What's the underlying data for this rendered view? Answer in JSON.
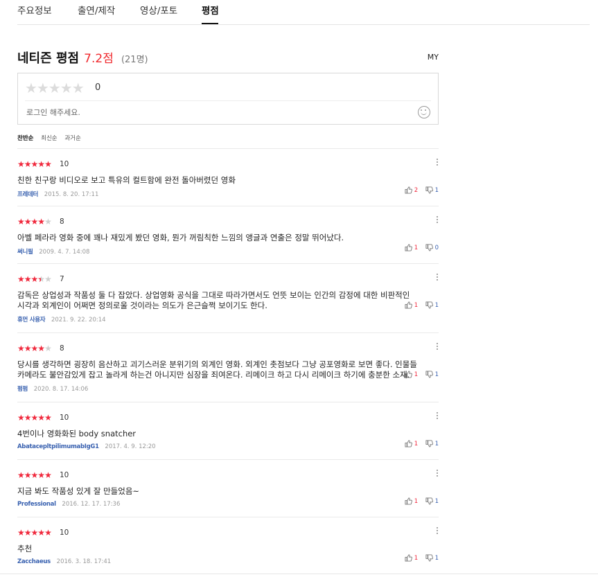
{
  "tabs": [
    "주요정보",
    "출연/제작",
    "영상/포토",
    "평점"
  ],
  "active_tab": "평점",
  "rating": {
    "title": "네티즌 평점",
    "score": "7.2점",
    "count": "(21명)",
    "my_label": "MY"
  },
  "input": {
    "stars": "★★★★★",
    "score": "0",
    "placeholder": "로그인 해주세요.",
    "emoji_icon": "smile-icon"
  },
  "sort": [
    "찬반순",
    "최신순",
    "과거순"
  ],
  "colors": {
    "accent": "#f0283c",
    "author": "#3a62b0",
    "star_off": "#cfcfcf"
  },
  "reviews": [
    {
      "rating": 5,
      "score": "10",
      "text": "친한 친구랑 비디오로 보고 특유의 컬트함에 완전 돌아버렸던 영화",
      "author": "프레데터",
      "date": "2015. 8. 20. 17:11",
      "likes": "2",
      "dislikes": "1"
    },
    {
      "rating": 4,
      "score": "8",
      "text": "아벨 페라라 영화 중에 꽤나 재밌게 봤던 영화, 뭔가 꺼림칙한 느낌의 앵글과 연출은 정말 뛰어났다.",
      "author": "써니필",
      "date": "2009. 4. 7. 14:08",
      "likes": "1",
      "dislikes": "0"
    },
    {
      "rating": 3.5,
      "score": "7",
      "text": "감독은 상업성과 작품성 둘 다 잡았다. 상업영화 공식을 그대로 따라가면서도 언뜻 보이는 인간의 감정에 대한 비판적인\n시각과 외계인이 어쩌면 정의로울 것이라는 의도가 은근슬쩍 보이기도 한다.",
      "author": "휴먼 사용자",
      "date": "2021. 9. 22. 20:14",
      "likes": "1",
      "dislikes": "1"
    },
    {
      "rating": 4,
      "score": "8",
      "text": "당시를 생각하면 굉장히 음산하고 괴기스러운 분위기의 외계인 영화. 외계인 촛점보다 그냥 공포영화로 보면 좋다. 인물들\n카메라도 불안감있게 잡고 놀라게 하는건 아니지만 심장을 죄여온다. 리메이크 하고 다시 리메이크 하기에 충분한 소재.",
      "author": "펌펌",
      "date": "2020. 8. 17. 14:06",
      "likes": "1",
      "dislikes": "1"
    },
    {
      "rating": 5,
      "score": "10",
      "text": "4번이나 영화화된 body snatcher",
      "author": "AbatacepltpilimumabIgG1",
      "date": "2017. 4. 9. 12:20",
      "likes": "1",
      "dislikes": "1"
    },
    {
      "rating": 5,
      "score": "10",
      "text": "지금 봐도 작품성 있게 잘 만들었음~",
      "author": "Professional",
      "date": "2016. 12. 17. 17:36",
      "likes": "1",
      "dislikes": "1"
    },
    {
      "rating": 5,
      "score": "10",
      "text": "추천",
      "author": "Zacchaeus",
      "date": "2016. 3. 18. 17:41",
      "likes": "1",
      "dislikes": "1"
    }
  ]
}
